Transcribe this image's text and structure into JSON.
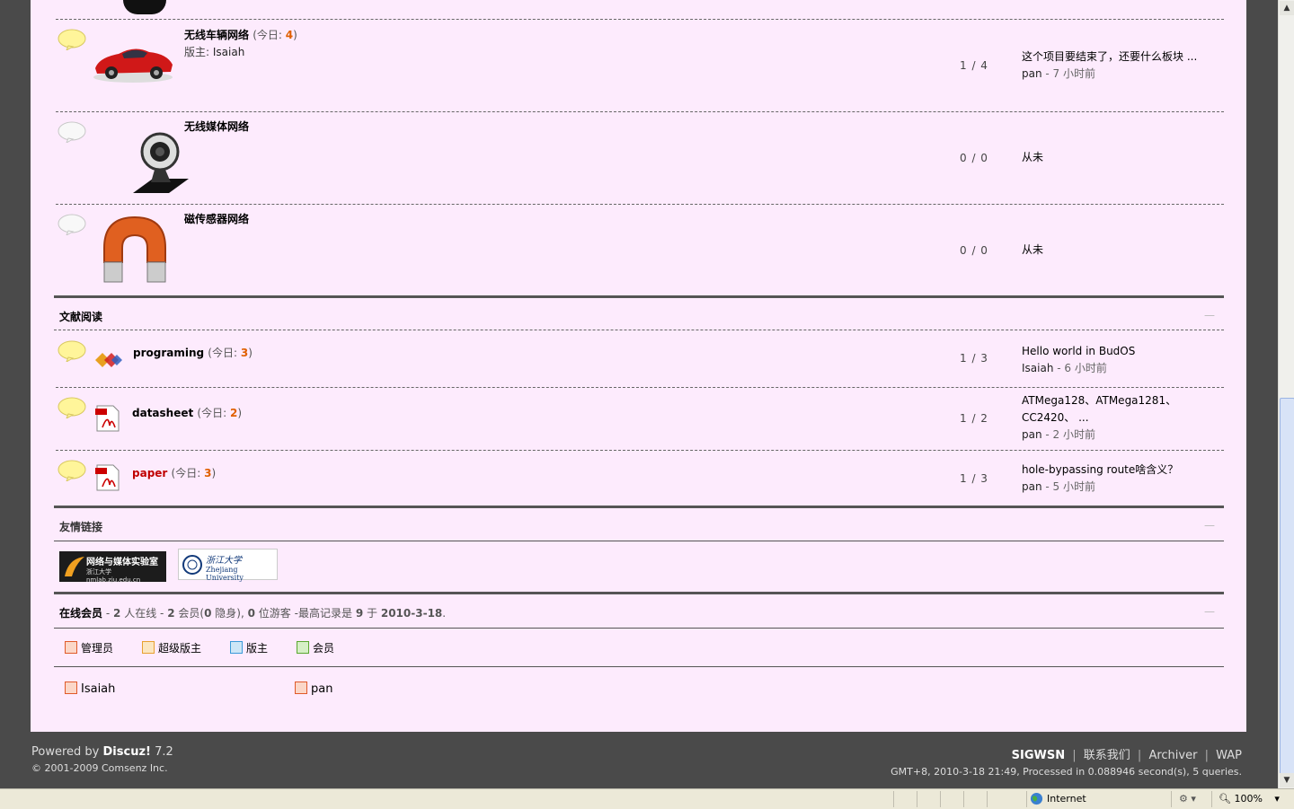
{
  "forums_top": [
    {
      "name": "无线车辆网络",
      "today_label": "今日:",
      "today_count": "4",
      "moderator_label": "版主:",
      "moderator": "Isaiah",
      "stats": "1 / 4",
      "last_title": "这个项目要结束了，还要什么板块 ...",
      "last_by": "pan",
      "last_ago": "- 7 小时前",
      "bubble": "yellow",
      "image": "red-car"
    },
    {
      "name": "无线媒体网络",
      "stats": "0 / 0",
      "last_title": "从未",
      "bubble": "grey",
      "image": "webcam"
    },
    {
      "name": "磁传感器网络",
      "stats": "0 / 0",
      "last_title": "从未",
      "bubble": "grey",
      "image": "horseshoe-magnet"
    }
  ],
  "section_reading": {
    "title": "文献阅读",
    "collapse": "—",
    "forums": [
      {
        "name": "programing",
        "today_label": "今日:",
        "today_count": "3",
        "stats": "1 / 3",
        "last_title": "Hello world in BudOS",
        "last_by": "Isaiah",
        "last_ago": "- 6 小时前",
        "bubble": "yellow",
        "image": "visual-studio-icon"
      },
      {
        "name": "datasheet",
        "today_label": "今日:",
        "today_count": "2",
        "stats": "1 / 2",
        "last_title": "ATMega128、ATMega1281、CC2420、 ...",
        "last_by": "pan",
        "last_ago": "- 2 小时前",
        "bubble": "yellow",
        "image": "pdf-icon"
      },
      {
        "name": "paper",
        "today_label": "今日:",
        "today_count": "3",
        "stats": "1 / 3",
        "last_title": "hole-bypassing route啥含义？",
        "last_by": "pan",
        "last_ago": "- 5 小时前",
        "bubble": "yellow",
        "image": "pdf-icon",
        "highlight": "#c00000"
      }
    ]
  },
  "links": {
    "title": "友情链接",
    "collapse": "—",
    "items": [
      {
        "text": "网络与媒体实验室",
        "sub": "浙江大学 nmlab.zju.edu.cn"
      },
      {
        "text": "浙江大学",
        "sub": "Zhejiang University"
      }
    ]
  },
  "online": {
    "title": "在线会员",
    "dash1": "-",
    "count": "2",
    "count_suffix": "人在线",
    "dash2": "-",
    "members": "2",
    "members_label": "会员(",
    "hidden": "0",
    "hidden_label": "隐身),",
    "guests": "0",
    "guests_label": "位游客",
    "dash3": "-",
    "record_label": "最高记录是",
    "record": "9",
    "record_mid": "于",
    "record_date": "2010-3-18",
    "period": ".",
    "collapse": "—",
    "legend": [
      {
        "label": "管理员",
        "color": "#e05a2a"
      },
      {
        "label": "超级版主",
        "color": "#e8a030"
      },
      {
        "label": "版主",
        "color": "#3a9ad9"
      },
      {
        "label": "会员",
        "color": "#5aa830"
      }
    ],
    "users": [
      {
        "name": "Isaiah",
        "color": "#e05a2a"
      },
      {
        "name": "pan",
        "color": "#e05a2a"
      }
    ]
  },
  "footer": {
    "powered": "Powered by",
    "brand": "Discuz!",
    "version": "7.2",
    "copyright": "© 2001-2009 Comsenz Inc.",
    "nav": [
      "SIGWSN",
      "联系我们",
      "Archiver",
      "WAP"
    ],
    "sep": "|",
    "processed": "GMT+8, 2010-3-18 21:49, Processed in 0.088946 second(s), 5 queries."
  },
  "statusbar": {
    "zone": "Internet",
    "zoom": "100%"
  }
}
